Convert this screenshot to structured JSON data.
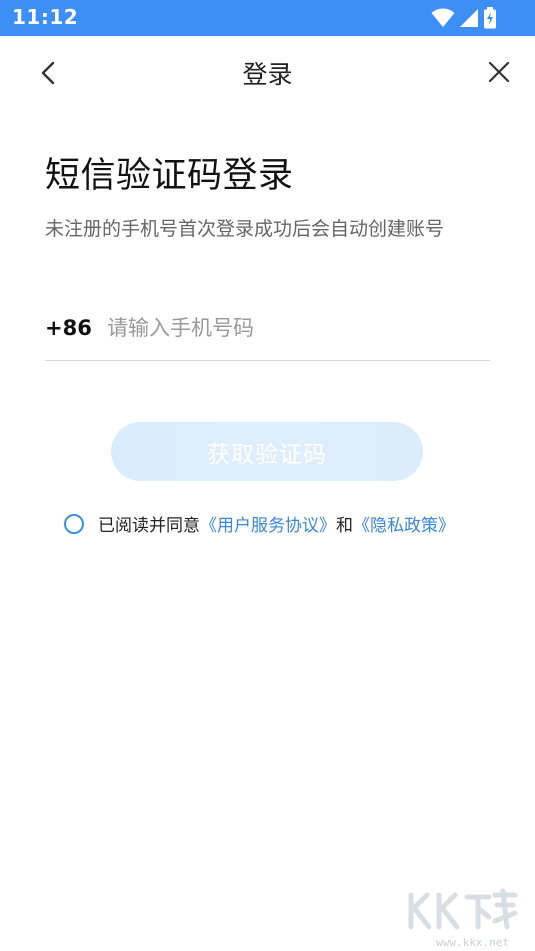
{
  "status_bar": {
    "time": "11:12",
    "icons": [
      "wifi-icon",
      "signal-icon",
      "battery-charging-icon"
    ],
    "background": "#3d8ff5"
  },
  "nav": {
    "title": "登录",
    "back_icon": "chevron-left-icon",
    "close_icon": "close-icon"
  },
  "login": {
    "heading": "短信验证码登录",
    "subtitle": "未注册的手机号首次登录成功后会自动创建账号",
    "country_code": "+86",
    "phone_value": "",
    "phone_placeholder": "请输入手机号码",
    "get_code_label": "获取验证码"
  },
  "agreement": {
    "prefix": "已阅读并同意",
    "user_agreement": "《用户服务协议》",
    "conjunction": "和",
    "privacy_policy": "《隐私政策》",
    "checked": false
  },
  "watermark": {
    "url": "www.kkx.net"
  },
  "colors": {
    "accent": "#3d8ff5",
    "link": "#3c86d6",
    "button_disabled": "#dcecfb"
  }
}
